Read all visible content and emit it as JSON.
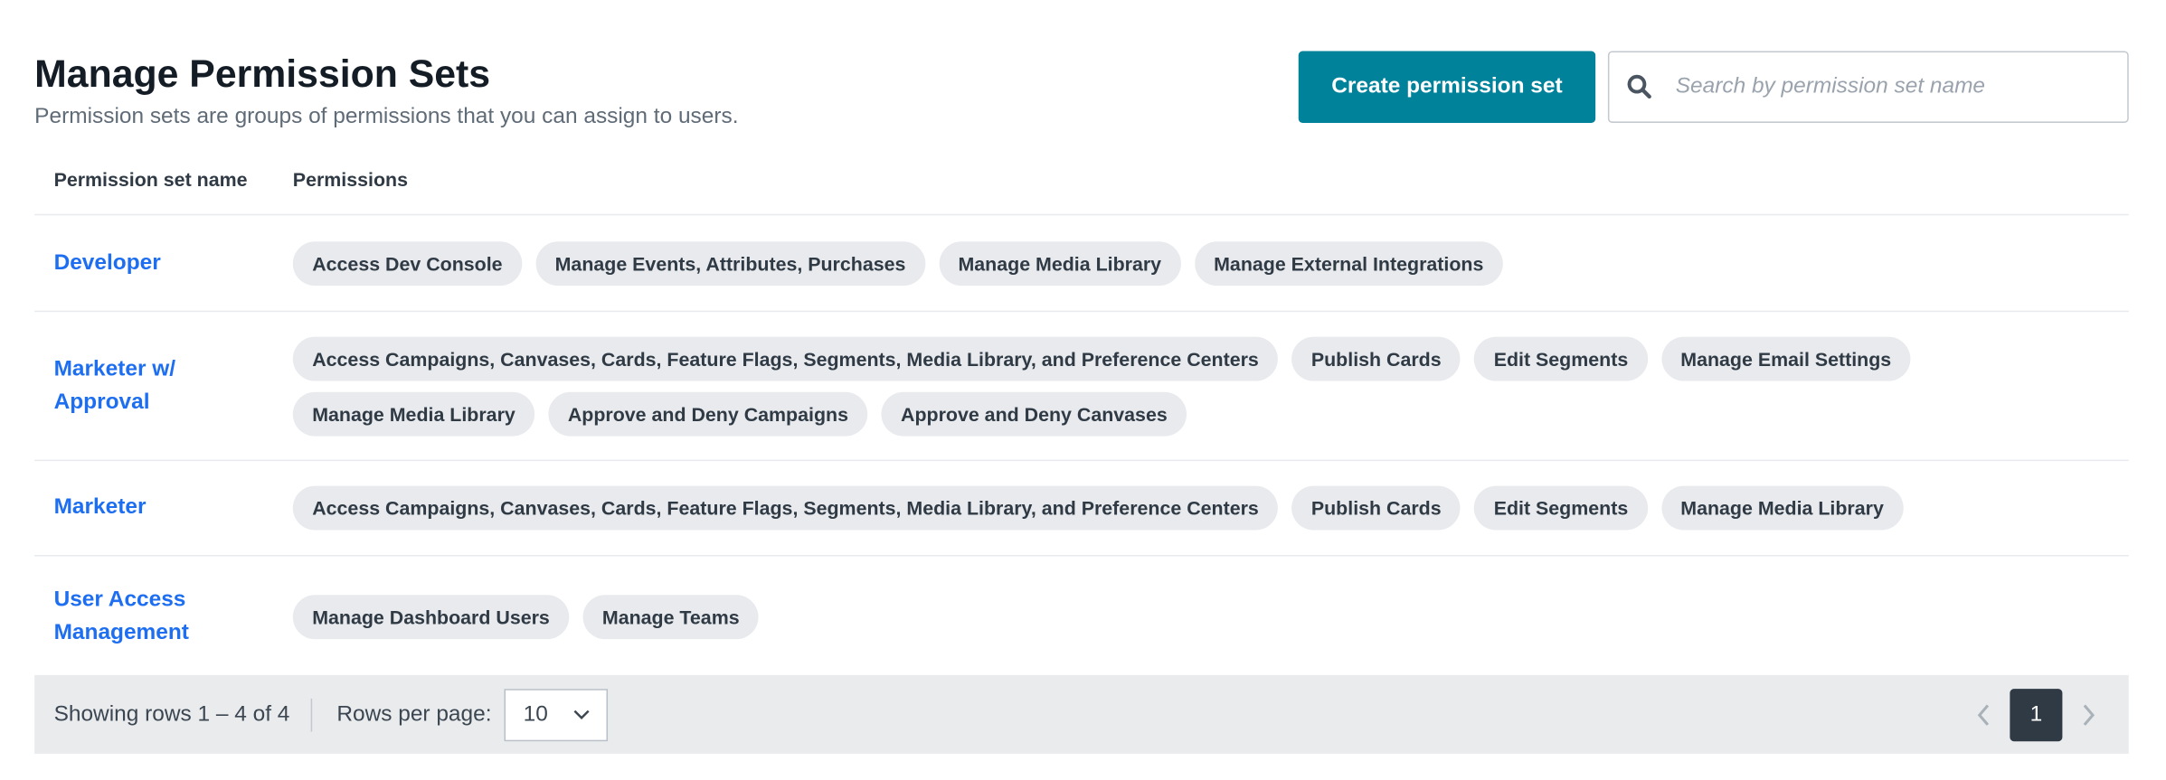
{
  "header": {
    "title": "Manage Permission Sets",
    "subtitle": "Permission sets are groups of permissions that you can assign to users.",
    "create_label": "Create permission set",
    "search_placeholder": "Search by permission set name"
  },
  "table": {
    "columns": [
      "Permission set name",
      "Permissions"
    ],
    "rows": [
      {
        "name": "Developer",
        "permissions": [
          "Access Dev Console",
          "Manage Events, Attributes, Purchases",
          "Manage Media Library",
          "Manage External Integrations"
        ]
      },
      {
        "name": "Marketer w/ Approval",
        "permissions": [
          "Access Campaigns, Canvases, Cards, Feature Flags, Segments, Media Library, and Preference Centers",
          "Publish Cards",
          "Edit Segments",
          "Manage Email Settings",
          "Manage Media Library",
          "Approve and Deny Campaigns",
          "Approve and Deny Canvases"
        ]
      },
      {
        "name": "Marketer",
        "permissions": [
          "Access Campaigns, Canvases, Cards, Feature Flags, Segments, Media Library, and Preference Centers",
          "Publish Cards",
          "Edit Segments",
          "Manage Media Library"
        ]
      },
      {
        "name": "User Access Management",
        "permissions": [
          "Manage Dashboard Users",
          "Manage Teams"
        ]
      }
    ]
  },
  "footer": {
    "showing": "Showing rows 1 – 4 of 4",
    "rows_per_page_label": "Rows per page:",
    "rows_per_page": "10",
    "current_page": "1"
  },
  "colors": {
    "accent": "#00829b",
    "link": "#1d6ef0",
    "chip_bg": "#e8eaed"
  }
}
